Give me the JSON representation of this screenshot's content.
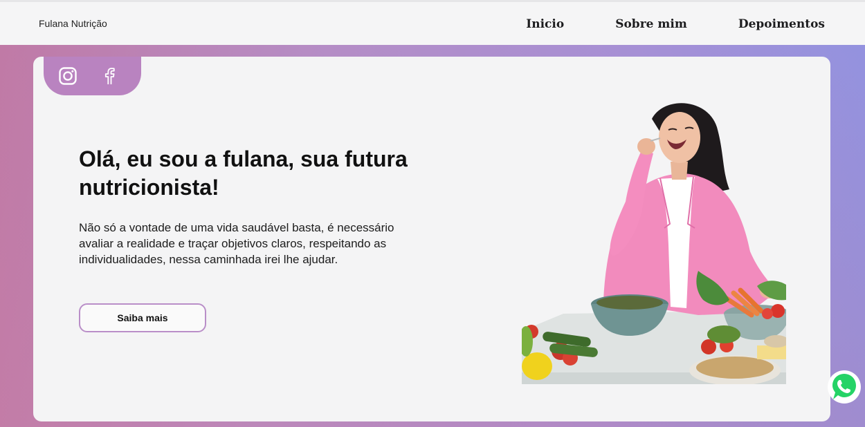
{
  "header": {
    "brand": "Fulana Nutrição",
    "nav": [
      {
        "label": "Inicio"
      },
      {
        "label": "Sobre mim"
      },
      {
        "label": "Depoimentos"
      }
    ]
  },
  "social": {
    "icons": [
      "instagram-icon",
      "facebook-icon"
    ]
  },
  "hero": {
    "title": "Olá, eu sou a fulana, sua futura nutricionista!",
    "description": "Não só a vontade de uma vida saudável basta, é necessário avaliar a realidade e traçar objetivos claros, respeitando as individualidades, nessa caminhada irei lhe ajudar.",
    "cta_label": "Saiba mais"
  },
  "colors": {
    "accent": "#b983c0",
    "button_border": "#b98ec8",
    "whatsapp": "#25d366"
  }
}
